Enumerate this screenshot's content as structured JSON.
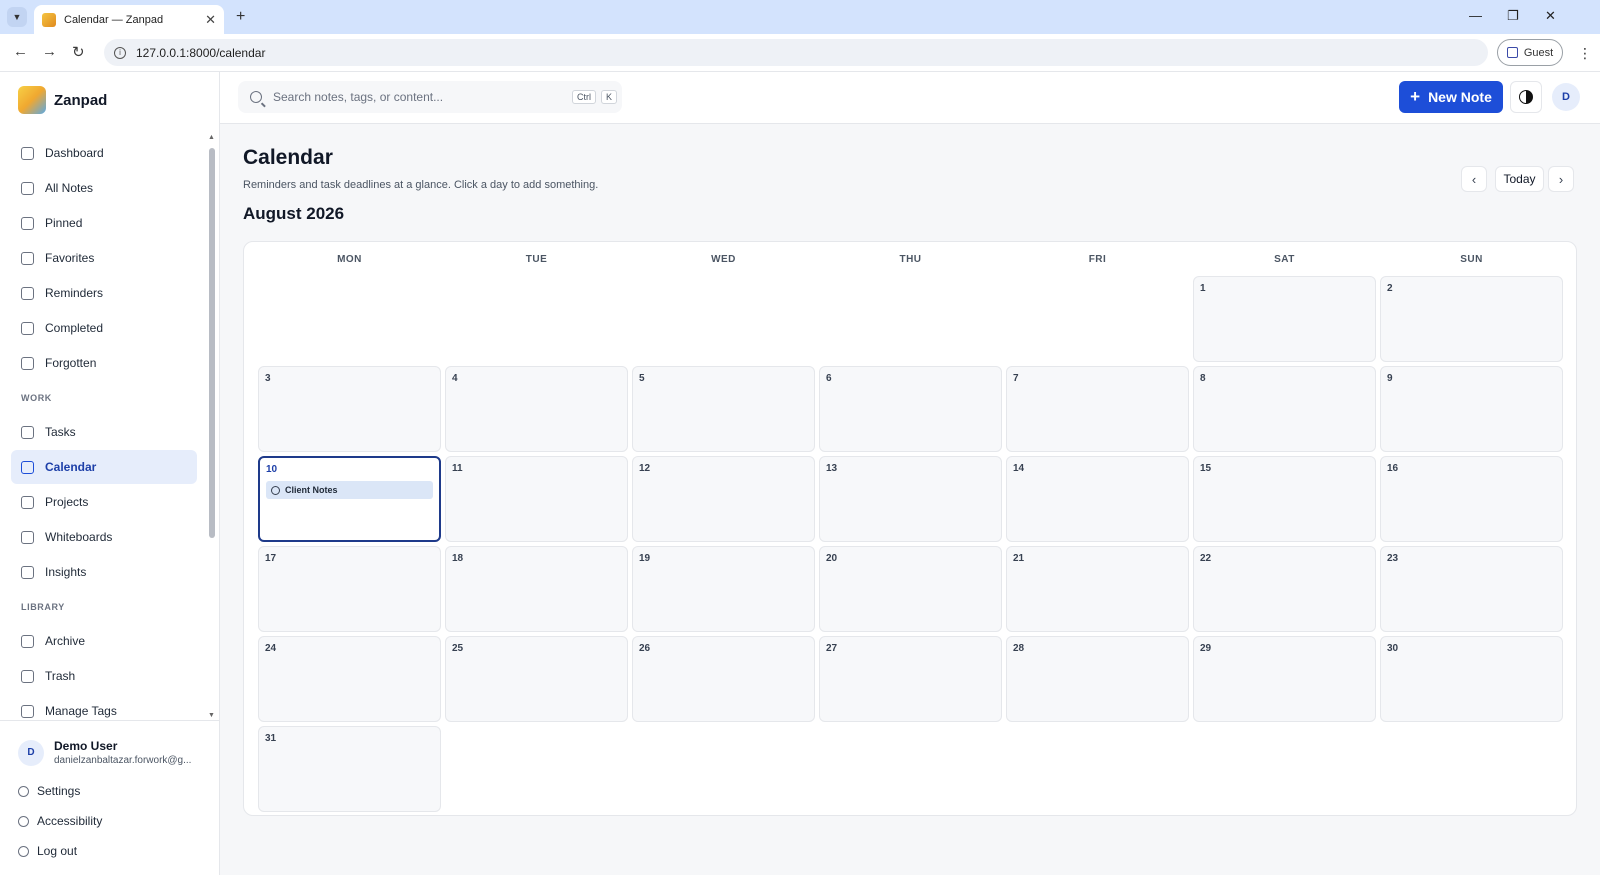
{
  "browser": {
    "tab_title": "Calendar — Zanpad",
    "url": "127.0.0.1:8000/calendar",
    "profile_label": "Guest"
  },
  "app": {
    "name": "Zanpad"
  },
  "sidebar": {
    "items": [
      {
        "label": "Dashboard",
        "icon": "dashboard-icon"
      },
      {
        "label": "All Notes",
        "icon": "notes-icon"
      },
      {
        "label": "Pinned",
        "icon": "pin-icon"
      },
      {
        "label": "Favorites",
        "icon": "star-icon"
      },
      {
        "label": "Reminders",
        "icon": "alarm-icon"
      },
      {
        "label": "Completed",
        "icon": "check-circle-icon"
      },
      {
        "label": "Forgotten",
        "icon": "hourglass-icon"
      }
    ],
    "work_label": "WORK",
    "work_items": [
      {
        "label": "Tasks",
        "icon": "checkbox-icon"
      },
      {
        "label": "Calendar",
        "icon": "calendar-icon",
        "active": true
      },
      {
        "label": "Projects",
        "icon": "kanban-icon"
      },
      {
        "label": "Whiteboards",
        "icon": "whiteboard-icon"
      },
      {
        "label": "Insights",
        "icon": "chart-line-icon"
      }
    ],
    "library_label": "LIBRARY",
    "library_items": [
      {
        "label": "Archive",
        "icon": "archive-icon"
      },
      {
        "label": "Trash",
        "icon": "trash-icon"
      },
      {
        "label": "Manage Tags",
        "icon": "tag-icon"
      }
    ],
    "user": {
      "initial": "D",
      "name": "Demo User",
      "email": "danielzanbaltazar.forwork@g..."
    },
    "bottom_links": [
      {
        "label": "Settings",
        "icon": "gear-icon"
      },
      {
        "label": "Accessibility",
        "icon": "accessibility-icon"
      },
      {
        "label": "Log out",
        "icon": "logout-icon"
      }
    ]
  },
  "topbar": {
    "search_placeholder": "Search notes, tags, or content...",
    "shortcut_ctrl": "Ctrl",
    "shortcut_key": "K",
    "new_note_label": "New Note",
    "avatar_initial": "D"
  },
  "page": {
    "title": "Calendar",
    "subtitle": "Reminders and task deadlines at a glance. Click a day to add something.",
    "month_label": "August 2026",
    "today_label": "Today"
  },
  "calendar": {
    "weekdays": [
      "MON",
      "TUE",
      "WED",
      "THU",
      "FRI",
      "SAT",
      "SUN"
    ],
    "leading_blanks": 5,
    "days_in_month": 31,
    "selected_day": 10,
    "events": [
      {
        "day": 10,
        "title": "Client Notes",
        "icon": "alarm-icon"
      }
    ]
  }
}
